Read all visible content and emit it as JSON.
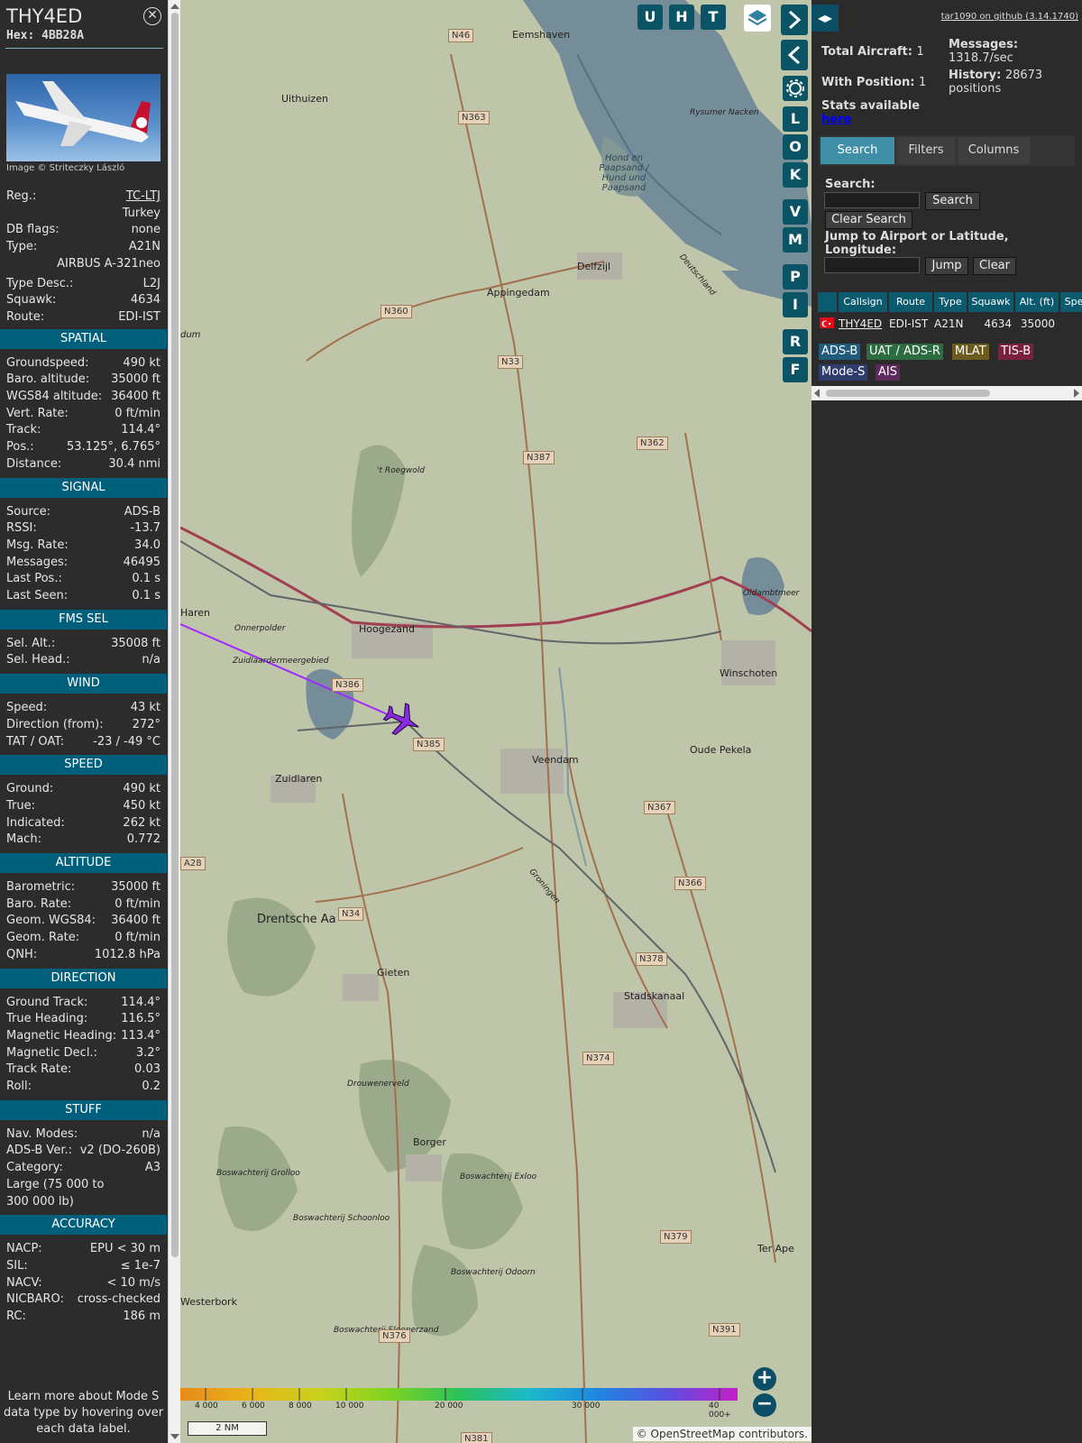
{
  "info": {
    "callsign": "THY4ED",
    "hex": "Hex: 4BB28A",
    "photo_credit": "Image © Striteczky László",
    "general": [
      {
        "label": "Reg.:",
        "value": "TC-LTJ"
      },
      {
        "label": "",
        "value": "Turkey"
      },
      {
        "label": "DB flags:",
        "value": "none"
      },
      {
        "label": "Type:",
        "value": "A21N"
      },
      {
        "label": "",
        "value": "AIRBUS A-321neo"
      },
      {
        "label": "Type Desc.:",
        "value": "L2J"
      },
      {
        "label": "Squawk:",
        "value": "4634"
      },
      {
        "label": "Route:",
        "value": "EDI-IST"
      }
    ],
    "sections": [
      {
        "title": "SPATIAL",
        "rows": [
          {
            "label": "Groundspeed:",
            "value": "490 kt"
          },
          {
            "label": "Baro. altitude:",
            "value": "35000 ft"
          },
          {
            "label": "WGS84 altitude:",
            "value": "36400 ft"
          },
          {
            "label": "Vert. Rate:",
            "value": "0 ft/min"
          },
          {
            "label": "Track:",
            "value": "114.4°"
          },
          {
            "label": "Pos.:",
            "value": "53.125°, 6.765°"
          },
          {
            "label": "Distance:",
            "value": "30.4 nmi"
          }
        ]
      },
      {
        "title": "SIGNAL",
        "rows": [
          {
            "label": "Source:",
            "value": "ADS-B"
          },
          {
            "label": "RSSI:",
            "value": "-13.7"
          },
          {
            "label": "Msg. Rate:",
            "value": "34.0"
          },
          {
            "label": "Messages:",
            "value": "46495"
          },
          {
            "label": "Last Pos.:",
            "value": "0.1 s"
          },
          {
            "label": "Last Seen:",
            "value": "0.1 s"
          }
        ]
      },
      {
        "title": "FMS SEL",
        "rows": [
          {
            "label": "Sel. Alt.:",
            "value": "35008 ft"
          },
          {
            "label": "Sel. Head.:",
            "value": "n/a"
          }
        ]
      },
      {
        "title": "WIND",
        "rows": [
          {
            "label": "Speed:",
            "value": "43 kt"
          },
          {
            "label": "Direction (from):",
            "value": "272°"
          },
          {
            "label": "TAT / OAT:",
            "value": "-23 / -49 °C"
          }
        ]
      },
      {
        "title": "SPEED",
        "rows": [
          {
            "label": "Ground:",
            "value": "490 kt"
          },
          {
            "label": "True:",
            "value": "450 kt"
          },
          {
            "label": "Indicated:",
            "value": "262 kt"
          },
          {
            "label": "Mach:",
            "value": "0.772"
          }
        ]
      },
      {
        "title": "ALTITUDE",
        "rows": [
          {
            "label": "Barometric:",
            "value": "35000 ft"
          },
          {
            "label": "Baro. Rate:",
            "value": "0 ft/min"
          },
          {
            "label": "Geom. WGS84:",
            "value": "36400 ft"
          },
          {
            "label": "Geom. Rate:",
            "value": "0 ft/min"
          },
          {
            "label": "QNH:",
            "value": "1012.8 hPa"
          }
        ]
      },
      {
        "title": "DIRECTION",
        "rows": [
          {
            "label": "Ground Track:",
            "value": "114.4°"
          },
          {
            "label": "True Heading:",
            "value": "116.5°"
          },
          {
            "label": "Magnetic Heading:",
            "value": "113.4°"
          },
          {
            "label": "Magnetic Decl.:",
            "value": "3.2°"
          },
          {
            "label": "Track Rate:",
            "value": "0.03"
          },
          {
            "label": "Roll:",
            "value": "0.2"
          }
        ]
      },
      {
        "title": "STUFF",
        "rows": [
          {
            "label": "Nav. Modes:",
            "value": "n/a"
          },
          {
            "label": "ADS-B Ver.:",
            "value": "v2 (DO-260B)"
          },
          {
            "label": "Category:",
            "value": "A3"
          },
          {
            "label": "Large (75 000 to",
            "value": ""
          },
          {
            "label": "300 000 lb)",
            "value": ""
          }
        ]
      },
      {
        "title": "ACCURACY",
        "rows": [
          {
            "label": "NACP:",
            "value": "EPU < 30 m"
          },
          {
            "label": "SIL:",
            "value": "≤ 1e-7"
          },
          {
            "label": "NACV:",
            "value": "< 10 m/s"
          },
          {
            "label": "NICBARO:",
            "value": "cross-checked"
          },
          {
            "label": "RC:",
            "value": "186 m"
          }
        ]
      }
    ],
    "footnote": "Learn more about Mode S data type by hovering over each data label."
  },
  "map": {
    "top_buttons": [
      "U",
      "H",
      "T"
    ],
    "side_buttons": [
      "L",
      "O",
      "K",
      "V",
      "M",
      "P",
      "I",
      "R",
      "F"
    ],
    "labels": {
      "places": [
        "Eemshaven",
        "Uithuizen",
        "Delfzijl",
        "Appingedam",
        "Hoogezand",
        "Haren",
        "Veendam",
        "Winschoten",
        "Oude Pekela",
        "Zuidlaren",
        "Gieten",
        "Stadskanaal",
        "Borger",
        "Westerbork",
        "Ter Ape",
        "Drentsche Aa",
        "Hond en Paapsand / Hund und Paapsand",
        "Rysumer Nacken",
        "Onnerpolder",
        "Zuidlaardermeergebied",
        "'t Roegwold",
        "Oldambtmeer",
        "Drouwenerveld",
        "Boswachterij Grolloo",
        "Boswachterij Exloo",
        "Boswachterij Schoonloo",
        "Boswachterij Odoorn",
        "Boswachterij Sleenerzand",
        "Groningen",
        "Deutschland",
        "dum"
      ],
      "roads": [
        "N46",
        "N363",
        "N360",
        "N33",
        "N387",
        "N362",
        "N386",
        "N385",
        "N367",
        "N366",
        "N34",
        "N378",
        "N374",
        "N379",
        "N376",
        "N391",
        "A28",
        "N381"
      ]
    },
    "scale_labels": [
      "4 000",
      "6 000",
      "8 000",
      "10 000",
      "20 000",
      "30 000",
      "40 000+"
    ],
    "scale_colors": [
      "#e88a1a",
      "#e8b41a",
      "#c9d21c",
      "#7ed321",
      "#2cc25b",
      "#1cb9c9",
      "#1f86e0",
      "#5a4fe0",
      "#c41ec8"
    ],
    "scale_bar": "2 NM",
    "attribution_prefix": "© ",
    "attribution_link": "OpenStreetMap",
    "attribution_suffix": " contributors.",
    "track_color": "#a228ff"
  },
  "side": {
    "github": "tar1090 on github (3.14.1740)",
    "total_label": "Total Aircraft:",
    "total_value": "1",
    "with_pos_label": "With Position:",
    "with_pos_value": "1",
    "stats_label": "Stats available",
    "stats_link": "here",
    "messages_label": "Messages:",
    "messages_value": "1318.7/sec",
    "history_label": "History:",
    "history_value": "28673 positions",
    "tabs": [
      "Search",
      "Filters",
      "Columns"
    ],
    "search_label": "Search:",
    "search_button": "Search",
    "clear_search": "Clear Search",
    "jump_label": "Jump to Airport or Latitude, Longitude:",
    "jump_button": "Jump",
    "clear_button": "Clear",
    "columns": [
      "Callsign",
      "Route",
      "Type",
      "Squawk",
      "Alt. (ft)",
      "Spe"
    ],
    "rows": [
      {
        "callsign": "THY4ED",
        "route": "EDI-IST",
        "type": "A21N",
        "squawk": "4634",
        "alt": "35000"
      }
    ],
    "sources": [
      {
        "label": "ADS-B",
        "bg": "#1f5b7a",
        "fg": "#fff"
      },
      {
        "label": "UAT / ADS-R",
        "bg": "#2d6b40",
        "fg": "#fff"
      },
      {
        "label": "MLAT",
        "bg": "#6b5b1f",
        "fg": "#fff"
      },
      {
        "label": "TIS-B",
        "bg": "#7a2040",
        "fg": "#fff"
      },
      {
        "label": "Mode-S",
        "bg": "#2f3d6e",
        "fg": "#fff"
      },
      {
        "label": "AIS",
        "bg": "#5e2a5e",
        "fg": "#fff"
      }
    ]
  }
}
